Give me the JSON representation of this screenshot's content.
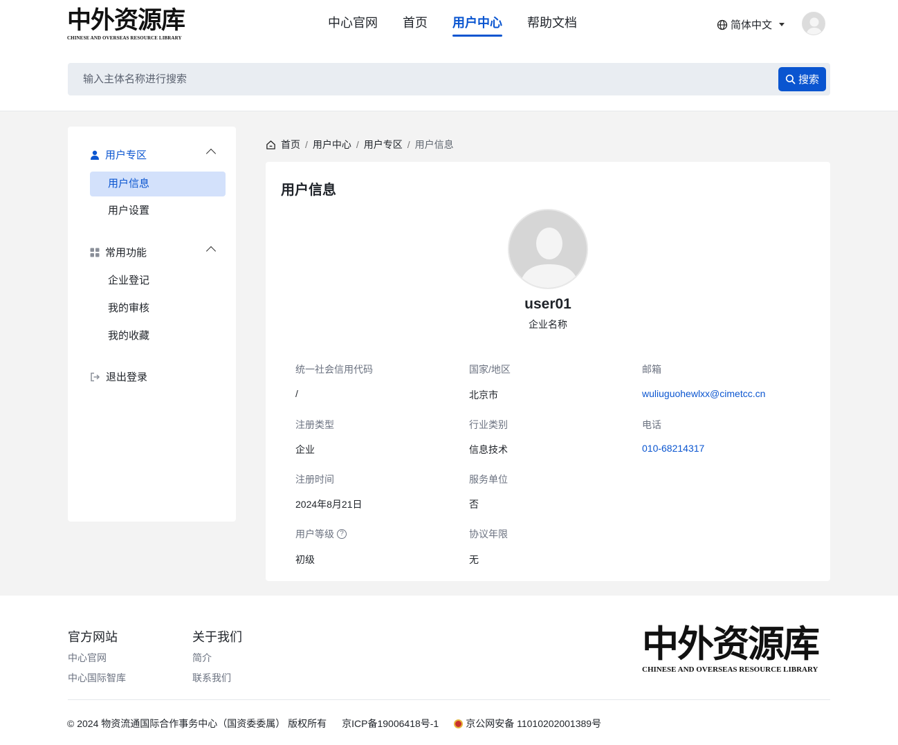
{
  "brand": {
    "name_cn": "中外资源库",
    "name_en": "CHINESE AND OVERSEAS RESOURCE LIBRARY"
  },
  "nav": {
    "items": [
      {
        "label": "中心官网"
      },
      {
        "label": "首页"
      },
      {
        "label": "用户中心"
      },
      {
        "label": "帮助文档"
      }
    ],
    "active": "用户中心"
  },
  "language": {
    "label": "简体中文"
  },
  "search": {
    "placeholder": "输入主体名称进行搜索",
    "button_label": "搜索"
  },
  "sidebar": {
    "group_user": {
      "label": "用户专区"
    },
    "user_items": [
      {
        "label": "用户信息"
      },
      {
        "label": "用户设置"
      }
    ],
    "group_common": {
      "label": "常用功能"
    },
    "common_items": [
      {
        "label": "企业登记"
      },
      {
        "label": "我的审核"
      },
      {
        "label": "我的收藏"
      }
    ],
    "logout": {
      "label": "退出登录"
    },
    "active_item": "用户信息"
  },
  "breadcrumb": [
    "首页",
    "用户中心",
    "用户专区",
    "用户信息"
  ],
  "profile": {
    "title": "用户信息",
    "username": "user01",
    "company": "企业名称",
    "fields": {
      "credit_code": {
        "label": "统一社会信用代码",
        "value": "/"
      },
      "region": {
        "label": "国家/地区",
        "value": "北京市"
      },
      "email": {
        "label": "邮箱",
        "value": "wuliuguohewlxx@cimetcc.cn"
      },
      "reg_type": {
        "label": "注册类型",
        "value": "企业"
      },
      "industry": {
        "label": "行业类别",
        "value": "信息技术"
      },
      "phone": {
        "label": "电话",
        "value": "010-68214317"
      },
      "reg_time": {
        "label": "注册时间",
        "value": "2024年8月21日"
      },
      "service_unit": {
        "label": "服务单位",
        "value": "否"
      },
      "user_level": {
        "label": "用户等级",
        "value": "初级"
      },
      "agreement_term": {
        "label": "协议年限",
        "value": "无"
      }
    }
  },
  "footer": {
    "col1": {
      "title": "官方网站",
      "links": [
        "中心官网",
        "中心国际智库"
      ]
    },
    "col2": {
      "title": "关于我们",
      "links": [
        "简介",
        "联系我们"
      ]
    },
    "copyright": "© 2024 物资流通国际合作事务中心（国资委委属） 版权所有",
    "icp": "京ICP备19006418号-1",
    "police": "京公网安备 11010202001389号"
  },
  "colors": {
    "accent": "#0a55d0",
    "active_bg": "#d3e1fb",
    "page_bg": "#f3f3f3"
  }
}
